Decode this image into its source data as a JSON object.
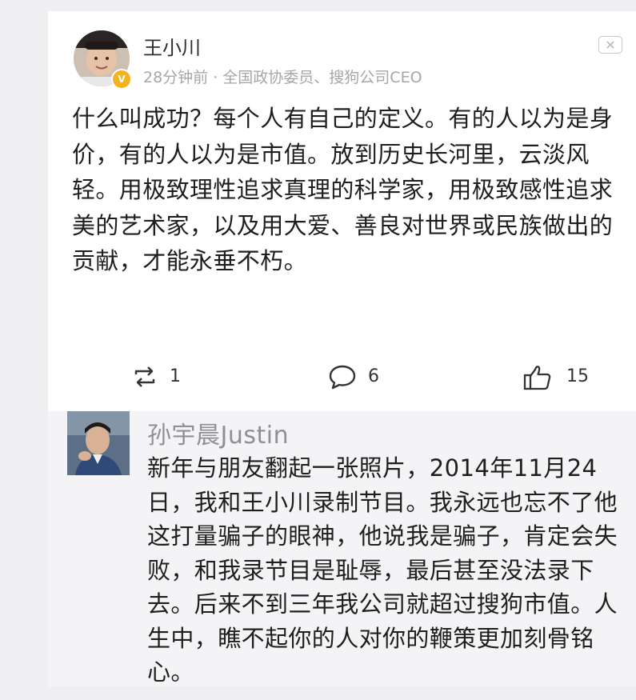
{
  "post": {
    "author": "王小川",
    "meta": "28分钟前 · 全国政协委员、搜狗公司CEO",
    "verified_icon": "v-badge-icon",
    "text": "什么叫成功？每个人有自己的定义。有的人以为是身价，有的人以为是市值。放到历史长河里，云淡风轻。用极致理性追求真理的科学家，用极致感性追求美的艺术家，以及用大爱、善良对世界或民族做出的贡献，才能永垂不朽。",
    "actions": {
      "repost_count": "1",
      "comment_count": "6",
      "like_count": "15"
    }
  },
  "reply": {
    "author": "孙宇晨Justin",
    "text": "新年与朋友翻起一张照片，2014年11月24日，我和王小川录制节目。我永远也忘不了他这打量骗子的眼神，他说我是骗子，肯定会失败，和我录节目是耻辱，最后甚至没法录下去。后来不到三年我公司就超过搜狗市值。人生中，瞧不起你的人对你的鞭策更加刻骨铭心。"
  },
  "colors": {
    "page_bg": "#efeff1",
    "card_bg": "#ffffff",
    "reply_bg": "#f4f4f6",
    "meta_gray": "#a6a6a6",
    "verified": "#f2b31d"
  }
}
